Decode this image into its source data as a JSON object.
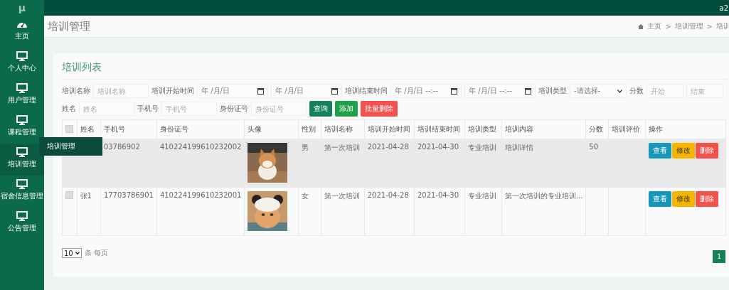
{
  "topbar": {
    "logo": "μ",
    "user": "a2"
  },
  "sidebar": {
    "items": [
      {
        "label": "主页",
        "selected": false
      },
      {
        "label": "个人中心",
        "selected": false
      },
      {
        "label": "用户管理",
        "selected": false
      },
      {
        "label": "课程管理",
        "selected": false
      },
      {
        "label": "培训管理",
        "selected": true
      },
      {
        "label": "宿舍信息管理",
        "selected": false
      },
      {
        "label": "公告管理",
        "selected": false
      }
    ]
  },
  "flyout": {
    "label": "培训管理"
  },
  "page": {
    "title": "培训管理",
    "breadcrumb": [
      "主页",
      "培训管理",
      "培训"
    ],
    "separator": ">"
  },
  "card": {
    "title": "培训列表"
  },
  "filters": [
    [
      {
        "kind": "label",
        "text": "培训名称"
      },
      {
        "kind": "input",
        "placeholder": "培训名称"
      },
      {
        "kind": "label",
        "text": "培训开始时间"
      },
      {
        "kind": "date",
        "value": "年 /月/日"
      },
      {
        "kind": "date",
        "value": "年 /月/日"
      },
      {
        "kind": "label",
        "text": "培训结束时间"
      },
      {
        "kind": "date",
        "value": "年 /月/日 --:--"
      },
      {
        "kind": "date",
        "value": "年 /月/日 --:--"
      },
      {
        "kind": "label",
        "text": "培训类型"
      },
      {
        "kind": "select",
        "value": "-请选择-"
      },
      {
        "kind": "label",
        "text": "分数"
      },
      {
        "kind": "short",
        "placeholder": "开始"
      },
      {
        "kind": "short",
        "placeholder": "结束"
      }
    ],
    [
      {
        "kind": "label",
        "text": "姓名"
      },
      {
        "kind": "input",
        "placeholder": "姓名"
      },
      {
        "kind": "label",
        "text": "手机号"
      },
      {
        "kind": "input",
        "placeholder": "手机号"
      },
      {
        "kind": "label",
        "text": "身份证号"
      },
      {
        "kind": "input",
        "placeholder": "身份证号"
      },
      {
        "kind": "button",
        "text": "查询"
      },
      {
        "kind": "button",
        "text": "添加"
      },
      {
        "kind": "button",
        "text": "批量删除"
      }
    ]
  ],
  "table": {
    "columns": [
      "姓名",
      "手机号",
      "身份证号",
      "头像",
      "性别",
      "培训名称",
      "培训开始时间",
      "培训结束时间",
      "培训类型",
      "培训内容",
      "分数",
      "培训评价",
      "操作"
    ],
    "header_checked": false,
    "rows": [
      {
        "hovered": true,
        "cells": [
          "",
          "03786902",
          "410224199610232002",
          null,
          "男",
          "第一次培训",
          "2021-04-28",
          "2021-04-30",
          "专业培训",
          "培训详情",
          "50",
          ""
        ],
        "actions": [
          "查看",
          "修改",
          "删除"
        ]
      },
      {
        "checked": false,
        "hovered": false,
        "cells": [
          "张1",
          "17703786901",
          "410224199610232001",
          null,
          "女",
          "第一次培训",
          "2021-04-28",
          "2021-04-30",
          "专业培训",
          "第一次培训的专业培训...",
          "",
          ""
        ],
        "actions": [
          "查看",
          "修改",
          "删除"
        ]
      }
    ]
  },
  "pagination": {
    "page_size": "10",
    "unit": "条 每页",
    "pages": [
      {
        "label": "1",
        "selected": true
      }
    ]
  }
}
